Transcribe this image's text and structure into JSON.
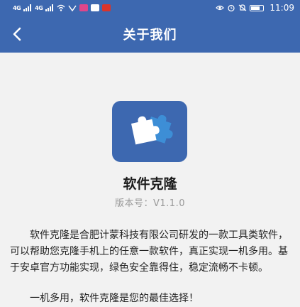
{
  "status_bar": {
    "signal_1": "4G",
    "signal_2": "4G",
    "time": "11:09",
    "icons": [
      "signal-icon",
      "signal-icon",
      "wifi-icon",
      "notification-icon",
      "app-icon",
      "app-icon",
      "app-icon",
      "eye-icon",
      "alarm-icon",
      "mute-icon",
      "battery-icon"
    ]
  },
  "header": {
    "title": "关于我们",
    "back_icon": "chevron-left-icon"
  },
  "app": {
    "logo_icon": "puzzle-icon",
    "name": "软件克隆",
    "version": "版本号：V1.1.0"
  },
  "content": {
    "description": "软件克隆是合肥计蒙科技有限公司研发的一款工具类软件，可以帮助您克隆手机上的任意一款软件，真正实现一机多用。基于安卓官方功能实现，绿色安全靠得住，稳定流畅不卡顿。",
    "slogan": "一机多用，软件克隆是您的最佳选择！"
  },
  "colors": {
    "primary": "#3d68b0",
    "background": "#f2f2f2",
    "text": "#222222",
    "muted": "#9a9a9a"
  }
}
